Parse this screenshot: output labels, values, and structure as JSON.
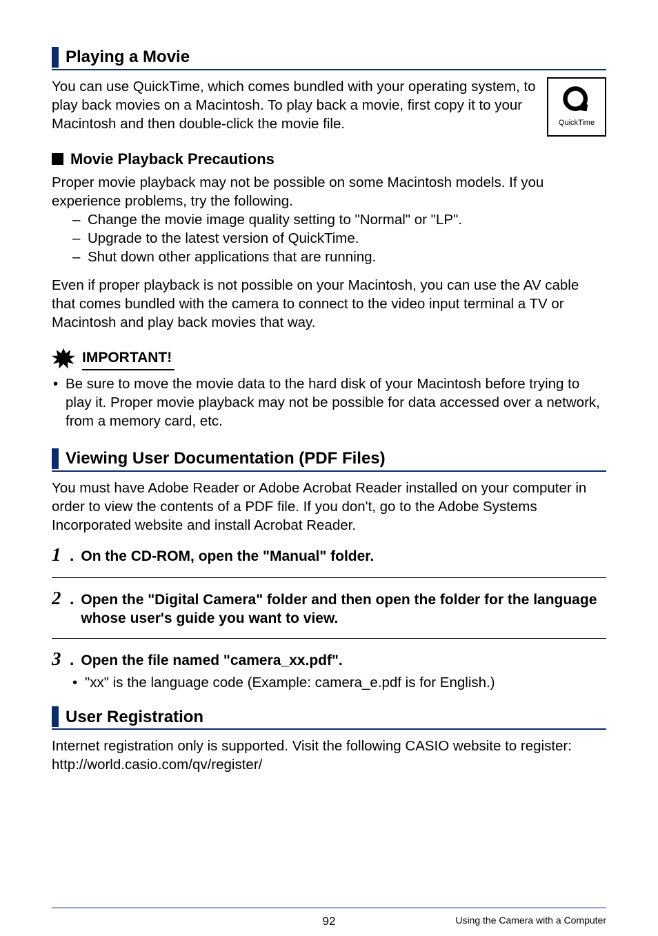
{
  "sections": {
    "playing_movie": {
      "title": "Playing a Movie",
      "intro": "You can use QuickTime, which comes bundled with your operating system, to play back movies on a Macintosh. To play back a movie, first copy it to your Macintosh and then double-click the movie file.",
      "quicktime_label": "QuickTime"
    },
    "playback_precautions": {
      "title": "Movie Playback Precautions",
      "intro": "Proper movie playback may not be possible on some Macintosh models. If you experience problems, try the following.",
      "items": [
        "Change the movie image quality setting to \"Normal\" or \"LP\".",
        "Upgrade to the latest version of QuickTime.",
        "Shut down other applications that are running."
      ],
      "note": "Even if proper playback is not possible on your Macintosh, you can use the AV cable that comes bundled with the camera to connect to the video input terminal a TV or Macintosh and play back movies that way."
    },
    "important": {
      "label": "IMPORTANT!",
      "items": [
        "Be sure to move the movie data to the hard disk of your Macintosh before trying to play it. Proper movie playback may not be possible for data accessed over a network, from a memory card, etc."
      ]
    },
    "viewing_docs": {
      "title": "Viewing User Documentation (PDF Files)",
      "intro": "You must have Adobe Reader or Adobe Acrobat Reader installed on your computer in order to view the contents of a PDF file. If you don't, go to the Adobe Systems Incorporated website and install Acrobat Reader.",
      "steps": [
        "On the CD-ROM, open the \"Manual\" folder.",
        "Open the \"Digital Camera\" folder and then open the folder for the language whose user's guide you want to view.",
        "Open the file named \"camera_xx.pdf\"."
      ],
      "step3_note": "\"xx\" is the language code (Example: camera_e.pdf is for English.)"
    },
    "user_reg": {
      "title": "User Registration",
      "text": "Internet registration only is supported. Visit the following CASIO website to register:\nhttp://world.casio.com/qv/register/"
    }
  },
  "footer": {
    "page": "92",
    "chapter": "Using the Camera with a Computer"
  }
}
